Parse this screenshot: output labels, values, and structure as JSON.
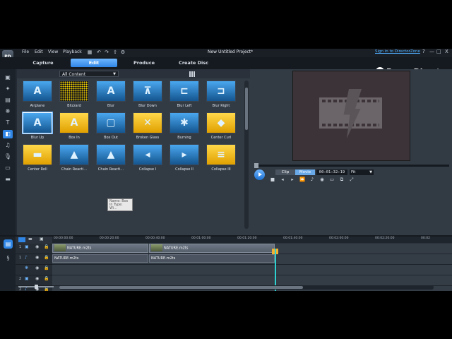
{
  "menubar": {
    "items": [
      "File",
      "Edit",
      "View",
      "Playback"
    ],
    "title": "New Untitled Project*",
    "signin": "Sign in to DirectorZone",
    "window_controls": [
      "?",
      "—",
      "□",
      "X"
    ]
  },
  "tabs": {
    "items": [
      "Capture",
      "Edit",
      "Produce",
      "Create Disc"
    ],
    "active": "Edit"
  },
  "brand": "PowerDirector",
  "library": {
    "filter": "All Content",
    "items": [
      {
        "label": "Airplane",
        "style": "blue",
        "glyph": "A"
      },
      {
        "label": "Blizzard",
        "style": "snow",
        "glyph": ""
      },
      {
        "label": "Blur",
        "style": "blue",
        "glyph": "A"
      },
      {
        "label": "Blur Down",
        "style": "blue",
        "glyph": "⊼"
      },
      {
        "label": "Blur Left",
        "style": "blue",
        "glyph": "⊏"
      },
      {
        "label": "Blur Right",
        "style": "blue",
        "glyph": "⊐"
      },
      {
        "label": "Blur Up",
        "style": "blue",
        "glyph": "A"
      },
      {
        "label": "Box In",
        "style": "yellow",
        "glyph": "A"
      },
      {
        "label": "Box Out",
        "style": "blue",
        "glyph": "▢"
      },
      {
        "label": "Broken Glass",
        "style": "yellow",
        "glyph": "✕"
      },
      {
        "label": "Burning",
        "style": "blue",
        "glyph": "✱"
      },
      {
        "label": "Center Curl",
        "style": "yellow",
        "glyph": "◆"
      },
      {
        "label": "Center Roll",
        "style": "yellow",
        "glyph": "▬"
      },
      {
        "label": "Chain Reacti...",
        "style": "blue",
        "glyph": "▲"
      },
      {
        "label": "Chain Reacti...",
        "style": "blue",
        "glyph": "▲"
      },
      {
        "label": "Collapse I",
        "style": "blue",
        "glyph": "◂"
      },
      {
        "label": "Collapse II",
        "style": "blue",
        "glyph": "▸"
      },
      {
        "label": "Collapse III",
        "style": "yellow",
        "glyph": "≡"
      }
    ],
    "tooltip": "Name: Box In Type: Wi..."
  },
  "preview": {
    "modes": [
      "Clip",
      "Movie"
    ],
    "active_mode": "Movie",
    "timecode": "00:01:32:19",
    "fit": "Fit",
    "seek_fraction": 0.0
  },
  "timeline": {
    "ticks": [
      "00:00:00:00",
      "00:00:20:00",
      "00:00:40:00",
      "00:01:00:00",
      "00:01:20:00",
      "00:01:40:00",
      "00:02:00:00",
      "00:02:20:00",
      "00:02"
    ],
    "tracks": [
      "1",
      "1",
      "",
      "2",
      "2",
      "",
      "",
      ""
    ],
    "video_clips": [
      "NATURE.m2ts",
      "NATURE.m2ts"
    ],
    "audio_clips": [
      "NATURE.m2ts",
      "NATURE.m2ts"
    ]
  }
}
